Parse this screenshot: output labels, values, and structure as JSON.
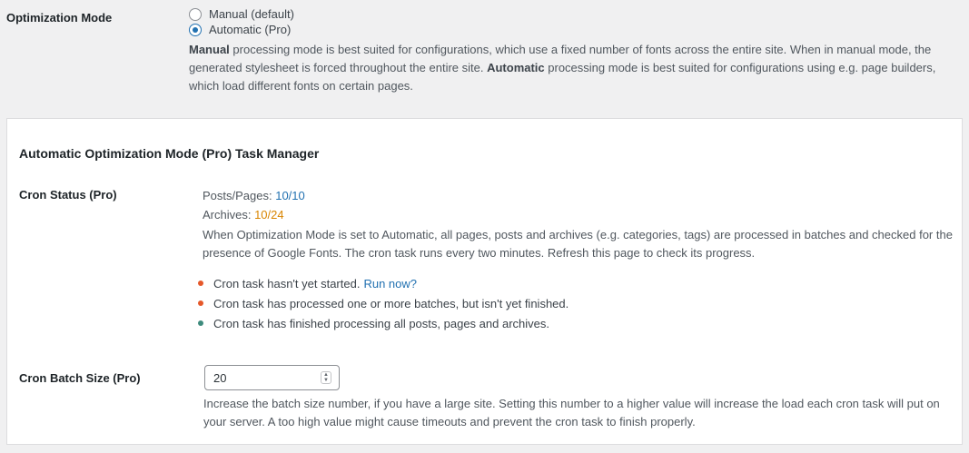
{
  "optimization": {
    "label": "Optimization Mode",
    "options": [
      {
        "label": "Manual (default)",
        "checked": false
      },
      {
        "label": "Automatic (Pro)",
        "checked": true
      }
    ],
    "desc_manual_bold": "Manual",
    "desc_part1": " processing mode is best suited for configurations, which use a fixed number of fonts across the entire site. When in manual mode, the generated stylesheet is forced throughout the entire site. ",
    "desc_auto_bold": "Automatic",
    "desc_part2": " processing mode is best suited for configurations using e.g. page builders, which load different fonts on certain pages."
  },
  "task_manager": {
    "title": "Automatic Optimization Mode (Pro) Task Manager",
    "cron_status": {
      "label": "Cron Status (Pro)",
      "posts_label": "Posts/Pages: ",
      "posts_value": "10/10",
      "archives_label": "Archives: ",
      "archives_value": "10/24",
      "description": "When Optimization Mode is set to Automatic, all pages, posts and archives (e.g. categories, tags) are processed in batches and checked for the presence of Google Fonts. The cron task runs every two minutes. Refresh this page to check its progress."
    },
    "legend": [
      {
        "text": "Cron task hasn't yet started.",
        "link": "Run now?"
      },
      {
        "text": "Cron task has processed one or more batches, but isn't yet finished."
      },
      {
        "text": "Cron task has finished processing all posts, pages and archives."
      }
    ],
    "batch_size": {
      "label": "Cron Batch Size (Pro)",
      "value": "20",
      "description": "Increase the batch size number, if you have a large site. Setting this number to a higher value will increase the load each cron task will put on your server. A too high value might cause timeouts and prevent the cron task to finish properly."
    }
  },
  "colors": {
    "accent_blue": "#2271b1",
    "orange_value": "#d98500",
    "dot_orange": "#e5582a",
    "dot_teal": "#3e8b7d"
  }
}
